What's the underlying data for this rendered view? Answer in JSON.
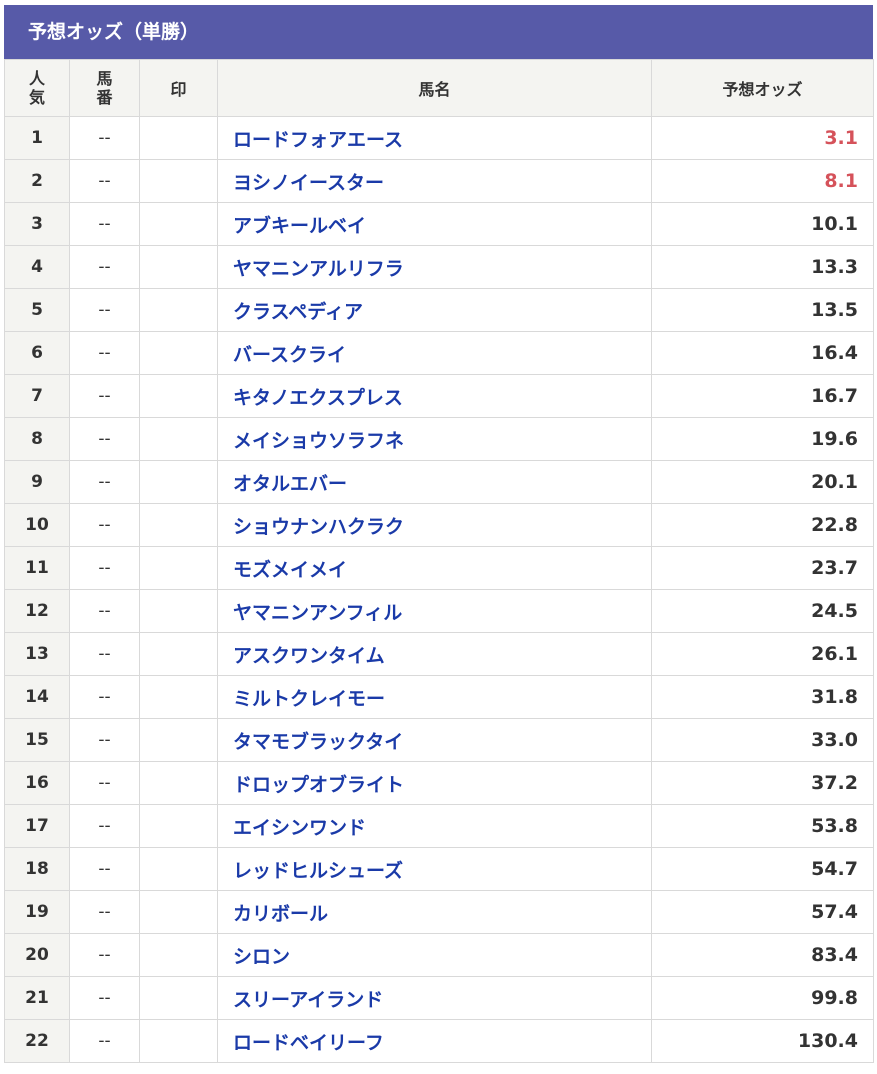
{
  "title": "予想オッズ（単勝）",
  "headers": {
    "popularity": [
      "人",
      "気"
    ],
    "horse_number": [
      "馬",
      "番"
    ],
    "mark": "印",
    "horse_name": "馬名",
    "odds": "予想オッズ"
  },
  "colors": {
    "header_bar": "#575aa8",
    "horse_link": "#1a3aa8",
    "favorite_odds": "#d5525a"
  },
  "rows": [
    {
      "rank": "1",
      "number": "--",
      "mark": "",
      "name": "ロードフォアエース",
      "odds": "3.1",
      "highlight": true
    },
    {
      "rank": "2",
      "number": "--",
      "mark": "",
      "name": "ヨシノイースター",
      "odds": "8.1",
      "highlight": true
    },
    {
      "rank": "3",
      "number": "--",
      "mark": "",
      "name": "アブキールベイ",
      "odds": "10.1",
      "highlight": false
    },
    {
      "rank": "4",
      "number": "--",
      "mark": "",
      "name": "ヤマニンアルリフラ",
      "odds": "13.3",
      "highlight": false
    },
    {
      "rank": "5",
      "number": "--",
      "mark": "",
      "name": "クラスペディア",
      "odds": "13.5",
      "highlight": false
    },
    {
      "rank": "6",
      "number": "--",
      "mark": "",
      "name": "バースクライ",
      "odds": "16.4",
      "highlight": false
    },
    {
      "rank": "7",
      "number": "--",
      "mark": "",
      "name": "キタノエクスプレス",
      "odds": "16.7",
      "highlight": false
    },
    {
      "rank": "8",
      "number": "--",
      "mark": "",
      "name": "メイショウソラフネ",
      "odds": "19.6",
      "highlight": false
    },
    {
      "rank": "9",
      "number": "--",
      "mark": "",
      "name": "オタルエバー",
      "odds": "20.1",
      "highlight": false
    },
    {
      "rank": "10",
      "number": "--",
      "mark": "",
      "name": "ショウナンハクラク",
      "odds": "22.8",
      "highlight": false
    },
    {
      "rank": "11",
      "number": "--",
      "mark": "",
      "name": "モズメイメイ",
      "odds": "23.7",
      "highlight": false
    },
    {
      "rank": "12",
      "number": "--",
      "mark": "",
      "name": "ヤマニンアンフィル",
      "odds": "24.5",
      "highlight": false
    },
    {
      "rank": "13",
      "number": "--",
      "mark": "",
      "name": "アスクワンタイム",
      "odds": "26.1",
      "highlight": false
    },
    {
      "rank": "14",
      "number": "--",
      "mark": "",
      "name": "ミルトクレイモー",
      "odds": "31.8",
      "highlight": false
    },
    {
      "rank": "15",
      "number": "--",
      "mark": "",
      "name": "タマモブラックタイ",
      "odds": "33.0",
      "highlight": false
    },
    {
      "rank": "16",
      "number": "--",
      "mark": "",
      "name": "ドロップオブライト",
      "odds": "37.2",
      "highlight": false
    },
    {
      "rank": "17",
      "number": "--",
      "mark": "",
      "name": "エイシンワンド",
      "odds": "53.8",
      "highlight": false
    },
    {
      "rank": "18",
      "number": "--",
      "mark": "",
      "name": "レッドヒルシューズ",
      "odds": "54.7",
      "highlight": false
    },
    {
      "rank": "19",
      "number": "--",
      "mark": "",
      "name": "カリボール",
      "odds": "57.4",
      "highlight": false
    },
    {
      "rank": "20",
      "number": "--",
      "mark": "",
      "name": "シロン",
      "odds": "83.4",
      "highlight": false
    },
    {
      "rank": "21",
      "number": "--",
      "mark": "",
      "name": "スリーアイランド",
      "odds": "99.8",
      "highlight": false
    },
    {
      "rank": "22",
      "number": "--",
      "mark": "",
      "name": "ロードベイリーフ",
      "odds": "130.4",
      "highlight": false
    }
  ]
}
